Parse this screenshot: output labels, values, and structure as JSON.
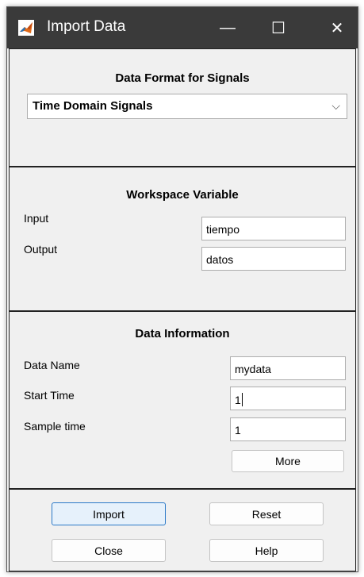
{
  "window": {
    "title": "Import Data",
    "controls": {
      "minimize": "—",
      "maximize": "☐",
      "close": "✕"
    }
  },
  "format_panel": {
    "title": "Data Format for Signals",
    "selected": "Time Domain Signals",
    "chevron": "⌵"
  },
  "workspace_panel": {
    "title": "Workspace Variable",
    "input_label": "Input",
    "input_value": "tiempo",
    "output_label": "Output",
    "output_value": "datos"
  },
  "info_panel": {
    "title": "Data Information",
    "data_name_label": "Data Name",
    "data_name_value": "mydata",
    "start_time_label": "Start Time",
    "start_time_value": "1",
    "sample_time_label": "Sample time",
    "sample_time_value": "1",
    "more_label": "More"
  },
  "actions": {
    "import": "Import",
    "reset": "Reset",
    "close": "Close",
    "help": "Help"
  },
  "colors": {
    "titlebar": "#3a3a3a",
    "panel_bg": "#f0f0f0",
    "primary_border": "#2b79c8"
  }
}
